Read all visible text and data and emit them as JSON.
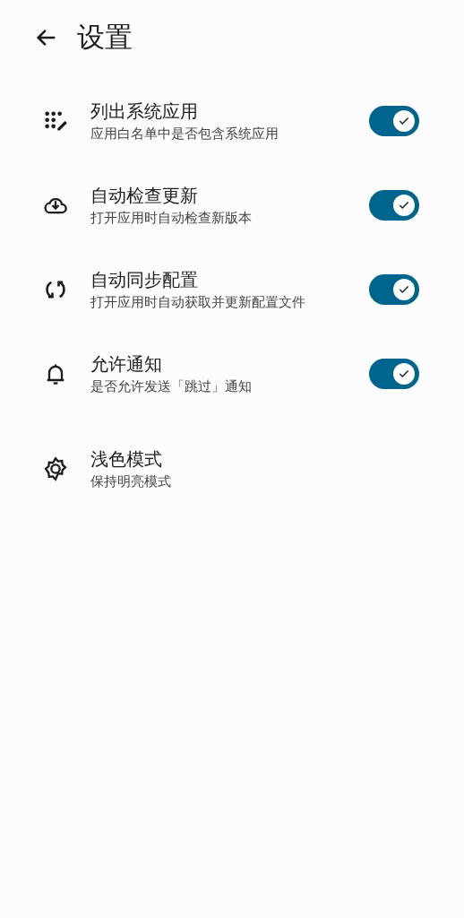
{
  "header": {
    "title": "设置"
  },
  "settings": [
    {
      "kind": "toggle",
      "title": "列出系统应用",
      "subtitle": "应用白名单中是否包含系统应用",
      "on": true
    },
    {
      "kind": "toggle",
      "title": "自动检查更新",
      "subtitle": "打开应用时自动检查新版本",
      "on": true
    },
    {
      "kind": "toggle",
      "title": "自动同步配置",
      "subtitle": "打开应用时自动获取并更新配置文件",
      "on": true
    },
    {
      "kind": "toggle",
      "title": "允许通知",
      "subtitle": "是否允许发送「跳过」通知",
      "on": true
    },
    {
      "kind": "plain",
      "title": "浅色模式",
      "subtitle": "保持明亮模式"
    }
  ]
}
